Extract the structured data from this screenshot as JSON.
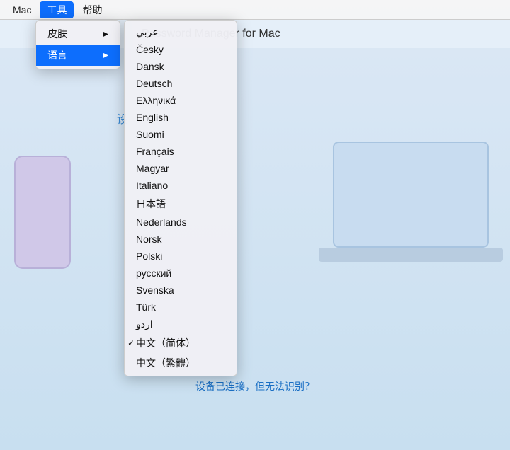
{
  "menubar": {
    "items": [
      "Mac",
      "工具",
      "帮助"
    ],
    "active_item": "工具"
  },
  "tools_menu": {
    "items": [
      {
        "label": "皮肤",
        "has_arrow": true,
        "active": false
      },
      {
        "label": "语言",
        "has_arrow": true,
        "active": true
      }
    ]
  },
  "lang_submenu": {
    "languages": [
      {
        "label": "عربي",
        "selected": false
      },
      {
        "label": "Česky",
        "selected": false
      },
      {
        "label": "Dansk",
        "selected": false
      },
      {
        "label": "Deutsch",
        "selected": false
      },
      {
        "label": "Ελληνικά",
        "selected": false
      },
      {
        "label": "English",
        "selected": false
      },
      {
        "label": "Suomi",
        "selected": false
      },
      {
        "label": "Français",
        "selected": false
      },
      {
        "label": "Magyar",
        "selected": false
      },
      {
        "label": "Italiano",
        "selected": false
      },
      {
        "label": "日本語",
        "selected": false
      },
      {
        "label": "Nederlands",
        "selected": false
      },
      {
        "label": "Norsk",
        "selected": false
      },
      {
        "label": "Polski",
        "selected": false
      },
      {
        "label": "русский",
        "selected": false
      },
      {
        "label": "Svenska",
        "selected": false
      },
      {
        "label": "Türk",
        "selected": false
      },
      {
        "label": "اردو",
        "selected": false
      },
      {
        "label": "中文（简体）",
        "selected": true
      },
      {
        "label": "中文（繁體）",
        "selected": false
      }
    ]
  },
  "app": {
    "title": "Password Manager for Mac",
    "connect_text": "设",
    "bottom_link": "设备已连接，但无法识别？"
  }
}
